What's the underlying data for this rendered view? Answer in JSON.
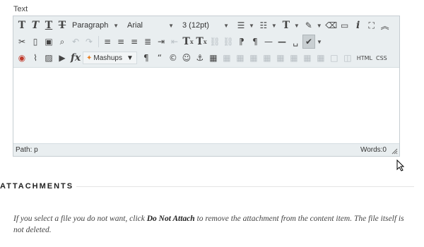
{
  "field": {
    "label": "Text"
  },
  "toolbar": {
    "row1": {
      "bold": "T",
      "italic": "T",
      "underline": "T",
      "strikethrough": "T",
      "format_select": "Paragraph",
      "font_select": "Arial",
      "size_select": "3 (12pt)",
      "text_color": "T",
      "spellcheck": "i"
    },
    "row2": {
      "superscript": "T",
      "subscript": "T",
      "superscript_mark": "x",
      "subscript_mark": "x"
    },
    "row3": {
      "math": "fx",
      "mashups": "Mashups",
      "pilcrow": "¶",
      "quote": "“",
      "copyright": "©",
      "html": "HTML",
      "css": "CSS"
    }
  },
  "status": {
    "path": "Path: p",
    "words": "Words:0"
  },
  "attachments": {
    "heading": "ATTACHMENTS",
    "note_prefix": "If you select a file you do not want, click ",
    "note_bold": "Do Not Attach",
    "note_suffix": " to remove the attachment from the content item. The file itself is not deleted."
  }
}
